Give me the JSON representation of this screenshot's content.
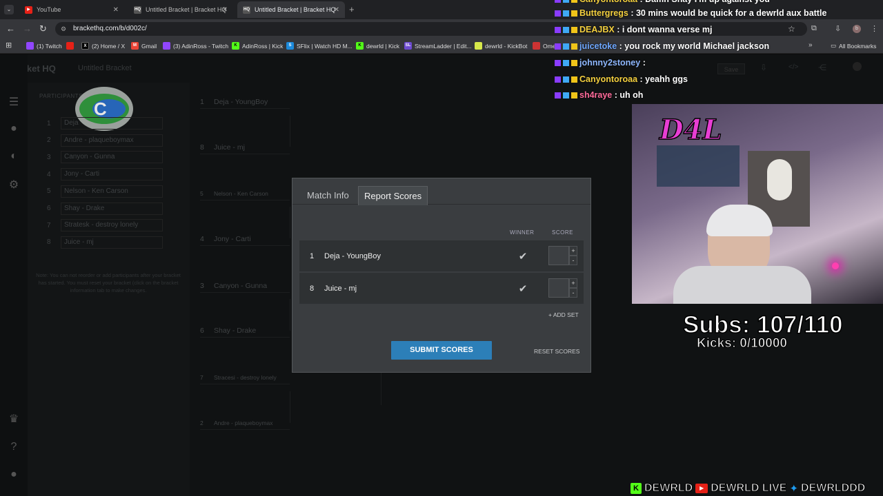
{
  "browser": {
    "tabs": [
      {
        "title": "YouTube",
        "active": false
      },
      {
        "title": "Untitled Bracket | Bracket HQ",
        "active": false
      },
      {
        "title": "Untitled Bracket | Bracket HQ",
        "active": true
      }
    ],
    "url": "brackethq.com/b/d002c/",
    "bookmarks": [
      "(1) Twitch",
      "(2) Home / X",
      "Gmail",
      "(3) AdinRoss - Twitch",
      "AdinRoss | Kick",
      "SFlix | Watch HD M...",
      "dewrld | Kick",
      "StreamLadder | Edit...",
      "dewrld - KickBot",
      "Ome"
    ],
    "all_bookmarks": "All Bookmarks"
  },
  "app": {
    "brand": "Bracket HQ",
    "bracket_title": "Untitled Bracket",
    "participants_label": "PARTICIPANTS",
    "participants": [
      {
        "seed": "1",
        "name": "Deja"
      },
      {
        "seed": "2",
        "name": "Andre - plaqueboymax"
      },
      {
        "seed": "3",
        "name": "Canyon - Gunna"
      },
      {
        "seed": "4",
        "name": "Jony - Carti"
      },
      {
        "seed": "5",
        "name": "Nelson - Ken Carson"
      },
      {
        "seed": "6",
        "name": "Shay - Drake"
      },
      {
        "seed": "7",
        "name": "Stratesk - destroy lonely"
      },
      {
        "seed": "8",
        "name": "Juice - mj"
      }
    ],
    "note": "Note: You can not reorder or add participants after your bracket has started. You must reset your bracket (click on the bracket information tab to make changes.",
    "save_label": "Save",
    "matches": [
      {
        "seed": "1",
        "name": "Deja - YoungBoy"
      },
      {
        "seed": "8",
        "name": "Juice - mj"
      },
      {
        "seed": "5",
        "name": "Nelson - Ken Carson"
      },
      {
        "seed": "4",
        "name": "Jony - Carti"
      },
      {
        "seed": "3",
        "name": "Canyon - Gunna"
      },
      {
        "seed": "6",
        "name": "Shay - Drake"
      },
      {
        "seed": "7",
        "name": "Stracesi - destroy lonely"
      },
      {
        "seed": "2",
        "name": "Andre - plaqueboymax"
      }
    ]
  },
  "modal": {
    "tabs": [
      "Match Info",
      "Report Scores"
    ],
    "active_tab": "Report Scores",
    "col_winner": "WINNER",
    "col_score": "SCORE",
    "rows": [
      {
        "seed": "1",
        "name": "Deja - YoungBoy",
        "score": ""
      },
      {
        "seed": "8",
        "name": "Juice - mj",
        "score": ""
      }
    ],
    "add_set": "+ ADD SET",
    "submit": "SUBMIT SCORES",
    "reset": "RESET SCORES",
    "accent": "#2c7fb8"
  },
  "chat": [
    {
      "user": "Canyontoroaa",
      "msg": "Damn Shay I'm up against you",
      "color": "#f4d03f"
    },
    {
      "user": "Buttergregs",
      "msg": "30 mins would be quick for a dewrld aux battle",
      "color": "#f4d03f"
    },
    {
      "user": "DEAJBX",
      "msg": "i dont wanna verse mj",
      "color": "#f4d03f"
    },
    {
      "user": "juicetoke",
      "msg": "you rock my world Michael jackson",
      "color": "#6fa8ff"
    },
    {
      "user": "johnny2stoney",
      "msg": "",
      "color": "#8fb8ff"
    },
    {
      "user": "Canyontoroaa",
      "msg": "yeahh ggs",
      "color": "#f4d03f"
    },
    {
      "user": "sh4raye",
      "msg": "uh oh",
      "color": "#ff6b9a"
    }
  ],
  "overlay": {
    "cam_tag": "D4L",
    "subs": "Subs: 107/110",
    "kicks": "Kicks: 0/10000",
    "socials": [
      "DEWRLD",
      "DEWRLD LIVE",
      "DEWRLDDD"
    ]
  }
}
